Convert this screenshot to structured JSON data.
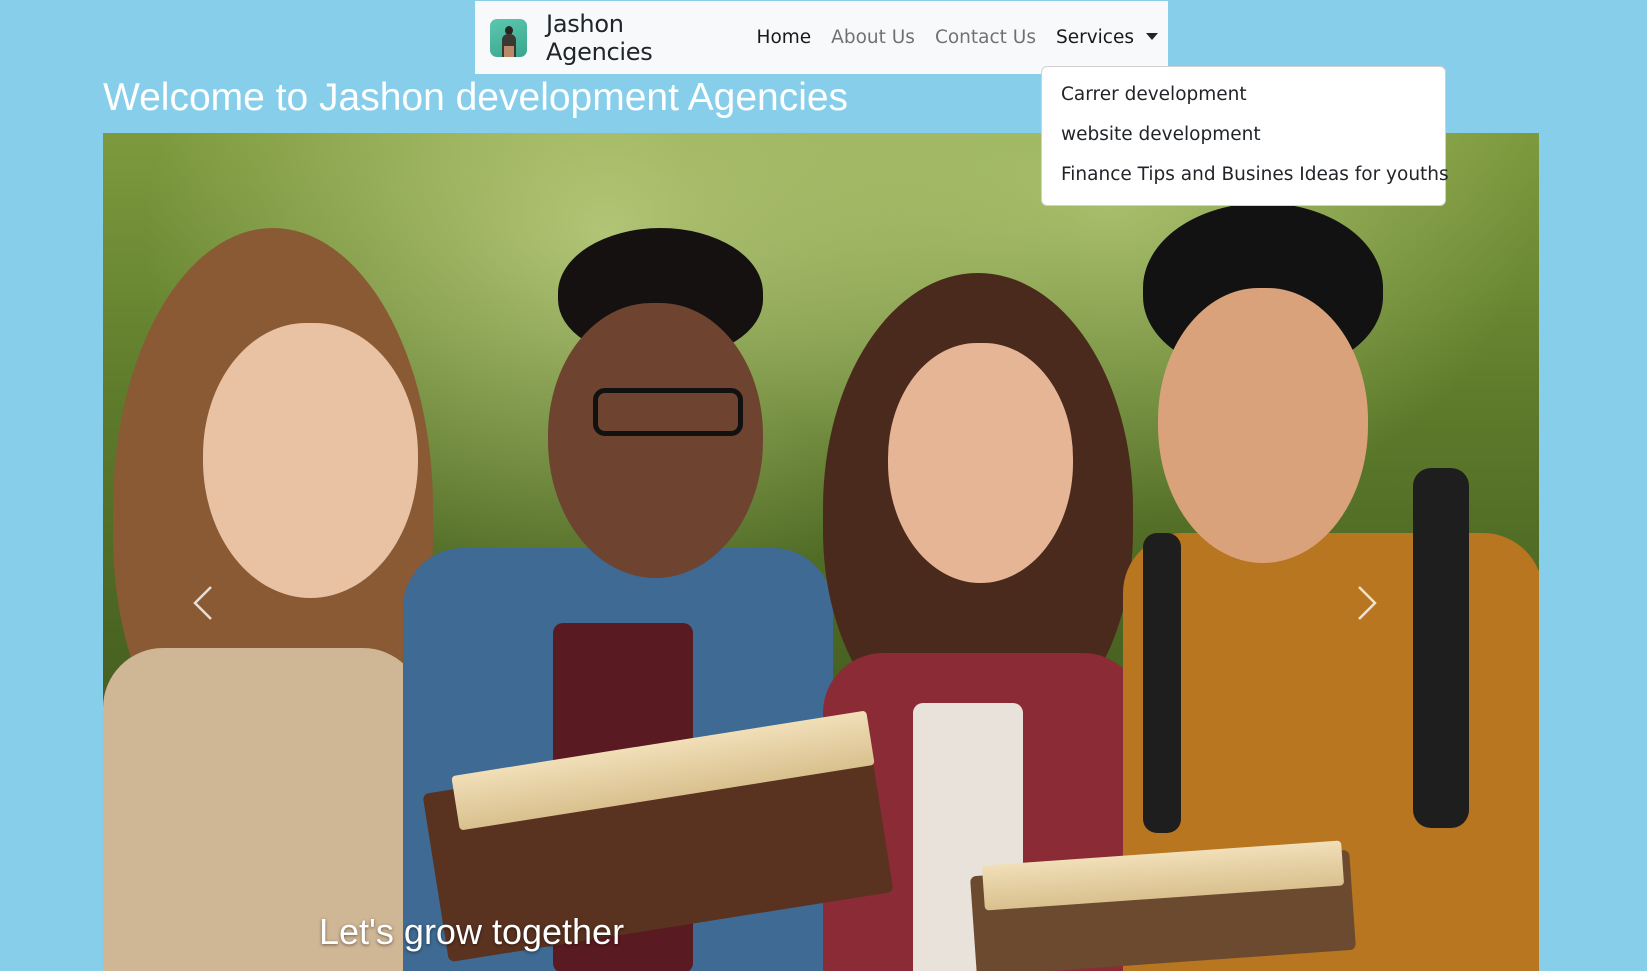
{
  "navbar": {
    "brand_name": "Jashon Agencies",
    "links": [
      {
        "label": "Home",
        "active": true
      },
      {
        "label": "About Us",
        "active": false
      },
      {
        "label": "Contact Us",
        "active": false
      }
    ],
    "services_label": "Services"
  },
  "dropdown": {
    "items": [
      "Carrer development",
      "website development",
      "Finance Tips and Busines Ideas for youths"
    ]
  },
  "page": {
    "welcome_heading": "Welcome to Jashon development Agencies"
  },
  "carousel": {
    "caption": "Let's grow together",
    "image_description_icon": "group-of-students-reading-image"
  },
  "colors": {
    "page_background": "#87ceeb",
    "navbar_background": "#f8f9fa",
    "heading_text": "#ffffff"
  }
}
